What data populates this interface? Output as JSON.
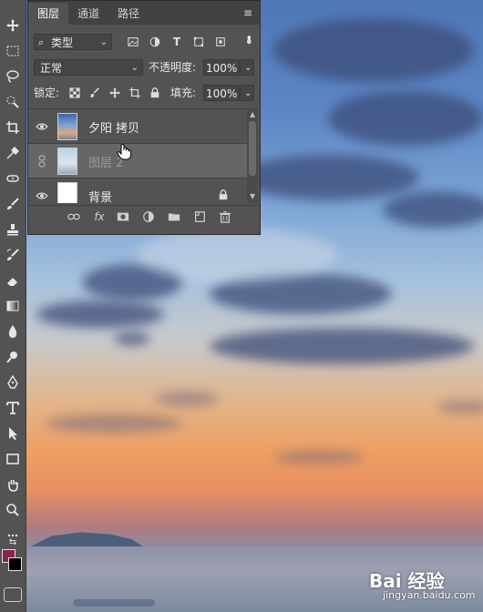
{
  "panel": {
    "tabs": [
      {
        "label": "图层"
      },
      {
        "label": "通道"
      },
      {
        "label": "路径"
      }
    ],
    "filter": {
      "label": "类型"
    },
    "blend_mode": "正常",
    "opacity_label": "不透明度:",
    "opacity_value": "100%",
    "lock_label": "锁定:",
    "fill_label": "填充:",
    "fill_value": "100%",
    "layers": [
      {
        "name": "夕阳 拷贝",
        "visible": true
      },
      {
        "name": "图层 2",
        "visible": false
      },
      {
        "name": "背景",
        "visible": true,
        "locked": true
      }
    ]
  },
  "watermark": {
    "brand": "Bai 经验",
    "url": "jingyan.baidu.com"
  },
  "colors": {
    "foreground": "#8a2250",
    "background": "#000000",
    "panel": "#535353"
  }
}
